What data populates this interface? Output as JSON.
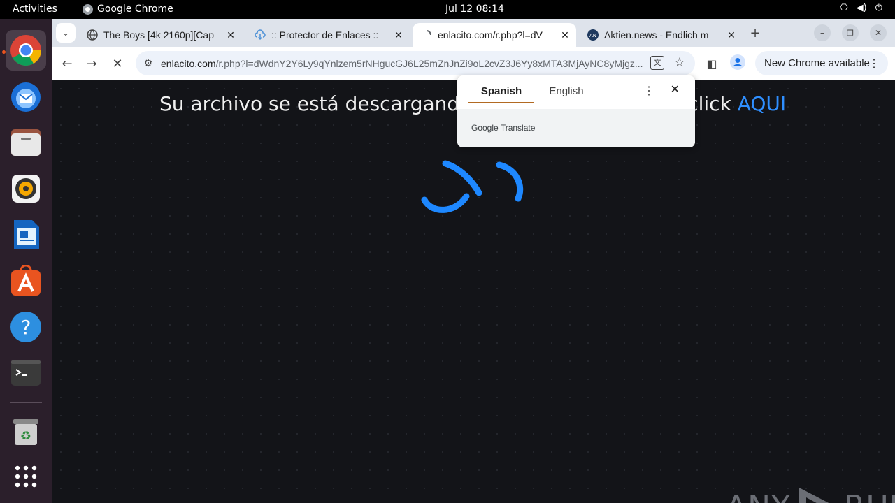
{
  "topbar": {
    "activities": "Activities",
    "app_name": "Google Chrome",
    "clock": "Jul 12  08:14",
    "tray_icons": [
      "network-icon",
      "volume-icon",
      "power-icon"
    ]
  },
  "dock": {
    "items": [
      "chrome-icon",
      "thunderbird-icon",
      "files-icon",
      "rhythmbox-icon",
      "writer-icon",
      "app-center-icon",
      "help-icon",
      "terminal-icon",
      "trash-icon",
      "app-grid-icon"
    ]
  },
  "tabs": [
    {
      "title": "The Boys [4k 2160p][Cap",
      "favicon": "globe-icon"
    },
    {
      "title": ":: Protector de Enlaces ::",
      "favicon": "cloud-download-icon"
    },
    {
      "title": "enlacito.com/r.php?l=dV",
      "favicon": "loading-icon"
    },
    {
      "title": "Aktien.news - Endlich m",
      "favicon": "aktien-icon"
    }
  ],
  "toolbar": {
    "url_domain": "enlacito.com",
    "url_path": "/r.php?l=dWdnY2Y6Ly9qYnlzem5rNHgucGJ6L25mZnJnZi9oL2cvZ3J6Yy8xMTA3MjAyNC8yMjgz...",
    "new_chrome": "New Chrome available"
  },
  "page": {
    "message_left": "Su archivo se está descargando,",
    "message_right": "click ",
    "link": "AQUI"
  },
  "translate": {
    "source_lang": "Spanish",
    "target_lang": "English",
    "footer": "Google Translate"
  },
  "watermark": {
    "left": "ANY",
    "right": "RUN"
  },
  "colors": {
    "accent_link": "#2f8fff",
    "spinner": "#1e88ff",
    "page_bg": "#131418",
    "translate_underline": "#b26a22"
  }
}
